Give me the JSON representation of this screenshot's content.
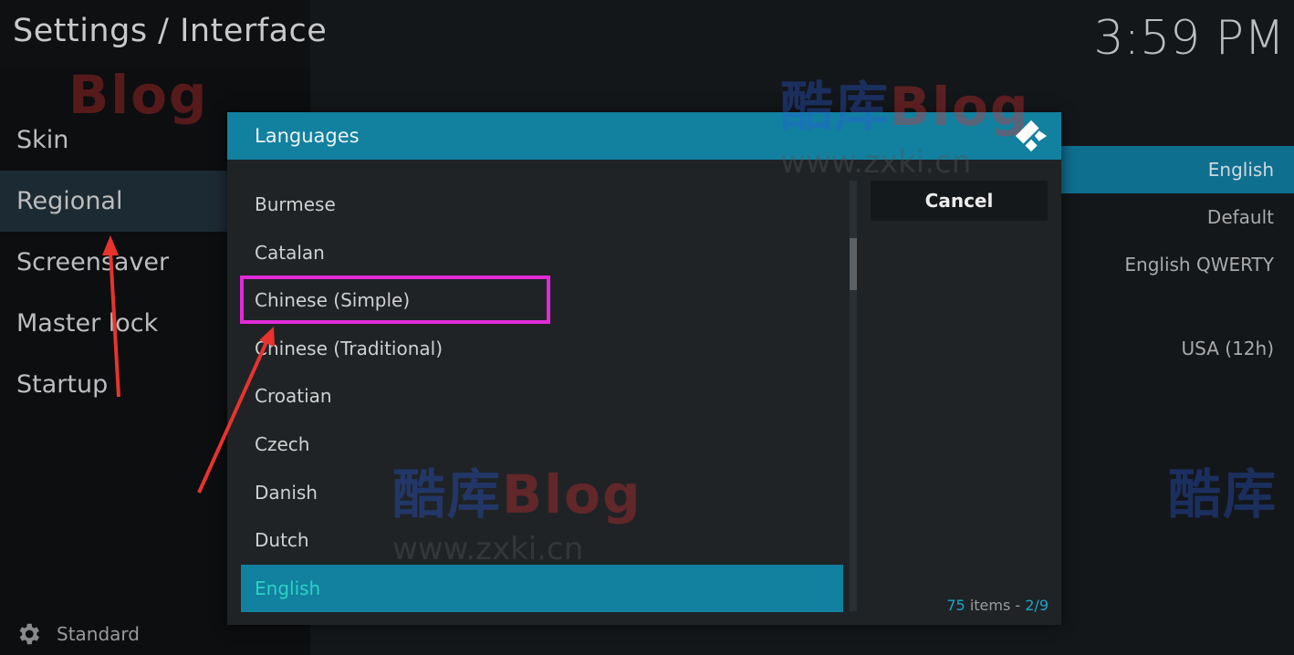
{
  "header": {
    "title": "Settings / Interface",
    "clock": "3:59 PM"
  },
  "sidebar": {
    "items": [
      {
        "label": "Skin"
      },
      {
        "label": "Regional"
      },
      {
        "label": "Screensaver"
      },
      {
        "label": "Master lock"
      },
      {
        "label": "Startup"
      }
    ]
  },
  "footer": {
    "level": "Standard"
  },
  "settings_values": [
    "English",
    "Default",
    "English QWERTY",
    "USA (12h)"
  ],
  "dialog": {
    "title": "Languages",
    "items": [
      "Burmese",
      "Catalan",
      "Chinese (Simple)",
      "Chinese (Traditional)",
      "Croatian",
      "Czech",
      "Danish",
      "Dutch",
      "English"
    ],
    "cancel": "Cancel",
    "count_num": "75",
    "count_word": " items - ",
    "page": "2/9"
  },
  "watermark": {
    "brand": "Blog",
    "chars": "酷库",
    "url": "www.zxki.cn"
  },
  "colors": {
    "accent": "#12809f",
    "selected_text": "#2bd2c4",
    "annotation": "#e22ad8",
    "arrow": "#e8332e"
  }
}
